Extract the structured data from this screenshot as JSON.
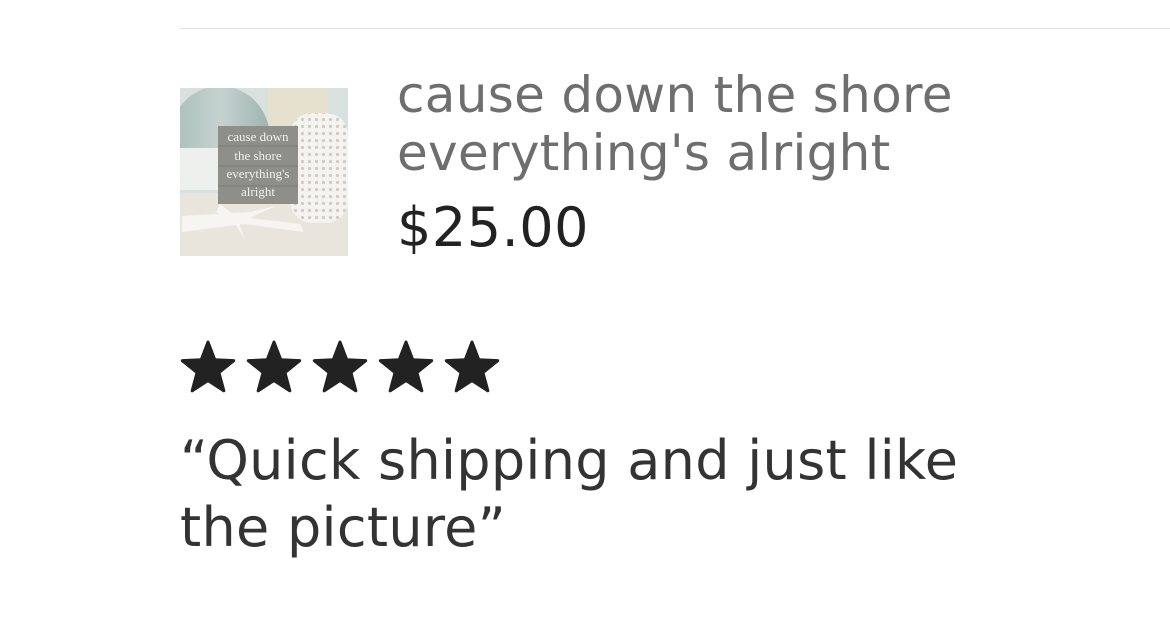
{
  "product": {
    "title": "cause down the shore everything's alright",
    "price": "$25.00",
    "image": {
      "sign_text": [
        "cause down",
        "the shore",
        "everything's",
        "alright"
      ]
    }
  },
  "review": {
    "rating": 5,
    "rating_max": 5,
    "text": "“Quick shipping and just like the picture”"
  },
  "colors": {
    "title": "#6e6e6e",
    "price": "#222222",
    "stars": "#222222",
    "review": "#333333",
    "divider": "#e1e3df"
  }
}
